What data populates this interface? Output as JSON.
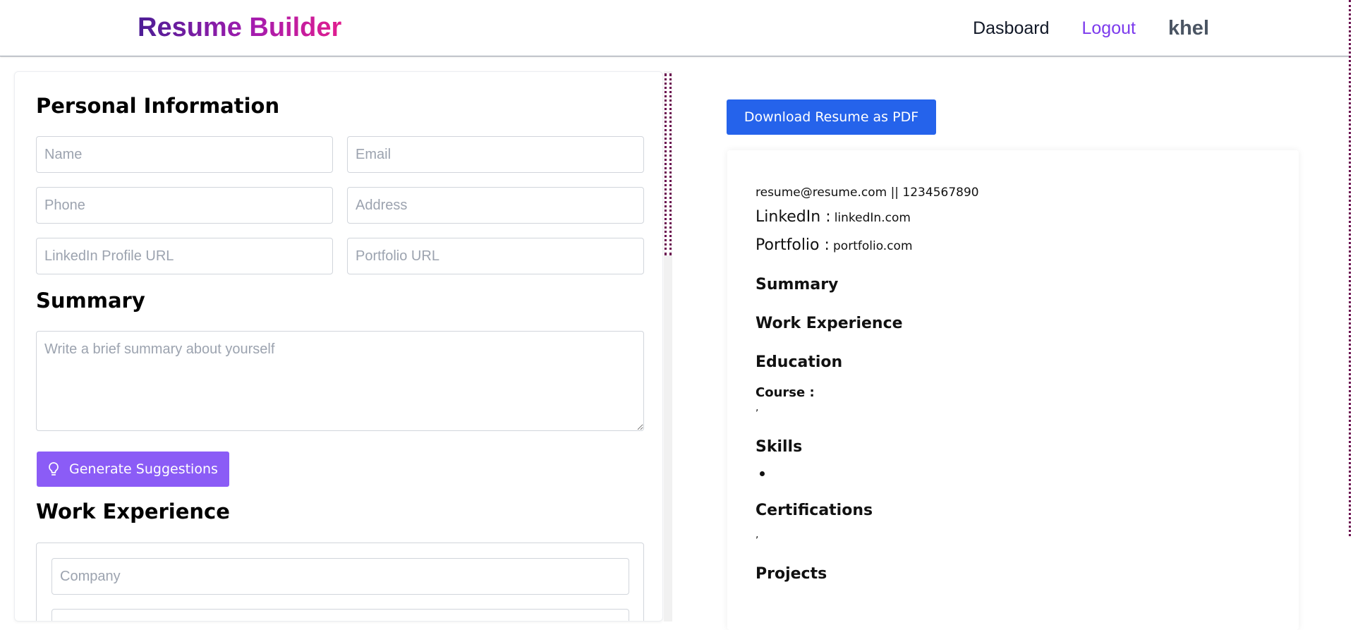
{
  "nav": {
    "brand": "Resume Builder",
    "dashboard": "Dasboard",
    "logout": "Logout",
    "user": "khel"
  },
  "form": {
    "personal_title": "Personal Information",
    "name_placeholder": "Name",
    "email_placeholder": "Email",
    "phone_placeholder": "Phone",
    "address_placeholder": "Address",
    "linkedin_placeholder": "LinkedIn Profile URL",
    "portfolio_placeholder": "Portfolio URL",
    "summary_title": "Summary",
    "summary_placeholder": "Write a brief summary about yourself",
    "generate_label": "Generate Suggestions",
    "work_title": "Work Experience",
    "company_placeholder": "Company"
  },
  "preview": {
    "download_label": "Download Resume as PDF",
    "contact": "resume@resume.com || 1234567890",
    "linkedin_key": "LinkedIn :",
    "linkedin_value": "linkedIn.com",
    "portfolio_key": "Portfolio :",
    "portfolio_value": "portfolio.com",
    "summary_heading": "Summary",
    "work_heading": "Work Experience",
    "education_heading": "Education",
    "course_label": "Course :",
    "education_comma": ",",
    "skills_heading": "Skills",
    "certifications_heading": "Certifications",
    "certifications_comma": ",",
    "projects_heading": "Projects"
  },
  "icons": {
    "generate": "lightbulb-icon"
  },
  "colors": {
    "brand_start": "#4c1d95",
    "brand_end": "#e11d8f",
    "logout": "#7c3aed",
    "generate_button": "#8b5cf6",
    "download_button": "#2563eb"
  }
}
